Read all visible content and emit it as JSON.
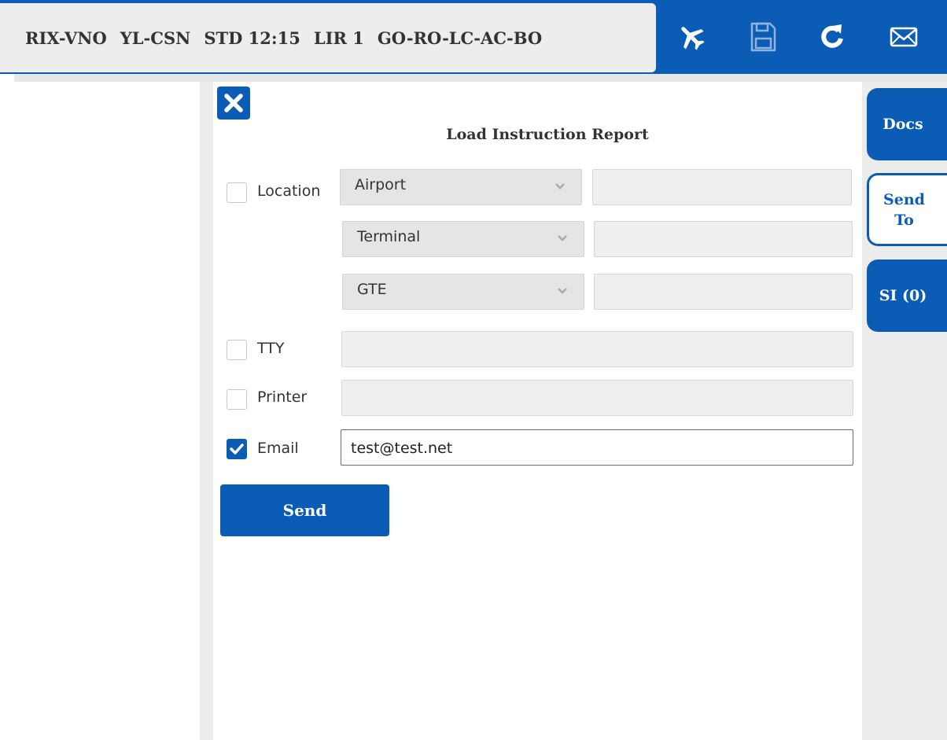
{
  "header": {
    "route": "RIX-VNO",
    "registration": "YL-CSN",
    "std": "STD 12:15",
    "lir": "LIR 1",
    "status_chain": "GO-RO-LC-AC-BO",
    "icons": [
      "plane-icon",
      "save-icon",
      "refresh-icon",
      "mail-icon"
    ]
  },
  "form": {
    "title": "Load Instruction Report",
    "location": {
      "label": "Location",
      "checked": false,
      "airport_select": "Airport",
      "terminal_select": "Terminal",
      "gate_select": "GTE",
      "airport_value": "",
      "terminal_value": "",
      "gate_value": ""
    },
    "tty": {
      "label": "TTY",
      "checked": false,
      "value": ""
    },
    "printer": {
      "label": "Printer",
      "checked": false,
      "value": ""
    },
    "email": {
      "label": "Email",
      "checked": true,
      "value": "test@test.net"
    },
    "send_label": "Send"
  },
  "side_tabs": [
    {
      "label": "Docs",
      "active": false
    },
    {
      "label": "Send To",
      "active": true
    },
    {
      "label": "SI (0)",
      "active": false
    }
  ],
  "colors": {
    "accent": "#0b5cb5",
    "panel_bg": "#ececec"
  }
}
